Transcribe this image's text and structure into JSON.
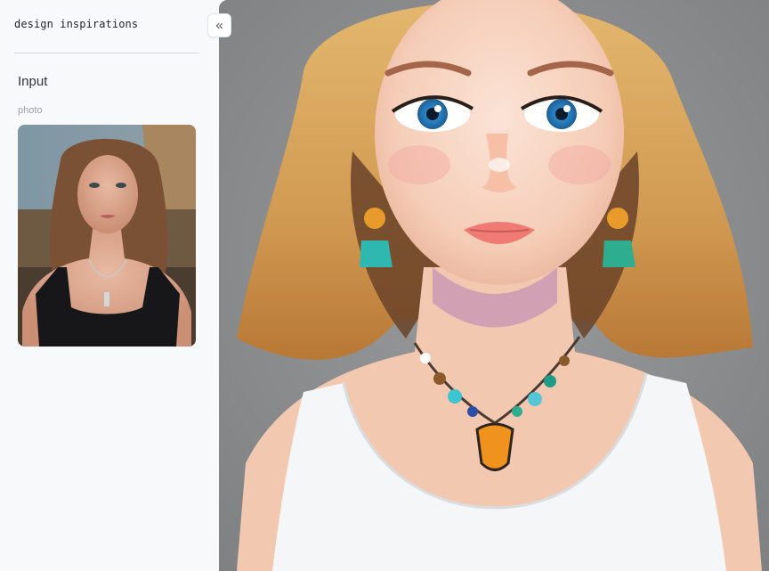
{
  "app": {
    "brand": "design inspirations"
  },
  "sidebar": {
    "section_title": "Input",
    "field_label": "photo",
    "collapse_icon": "«"
  },
  "images": {
    "input_photo": "portrait-photo-woman",
    "output_image": "painted-portrait-girl"
  }
}
